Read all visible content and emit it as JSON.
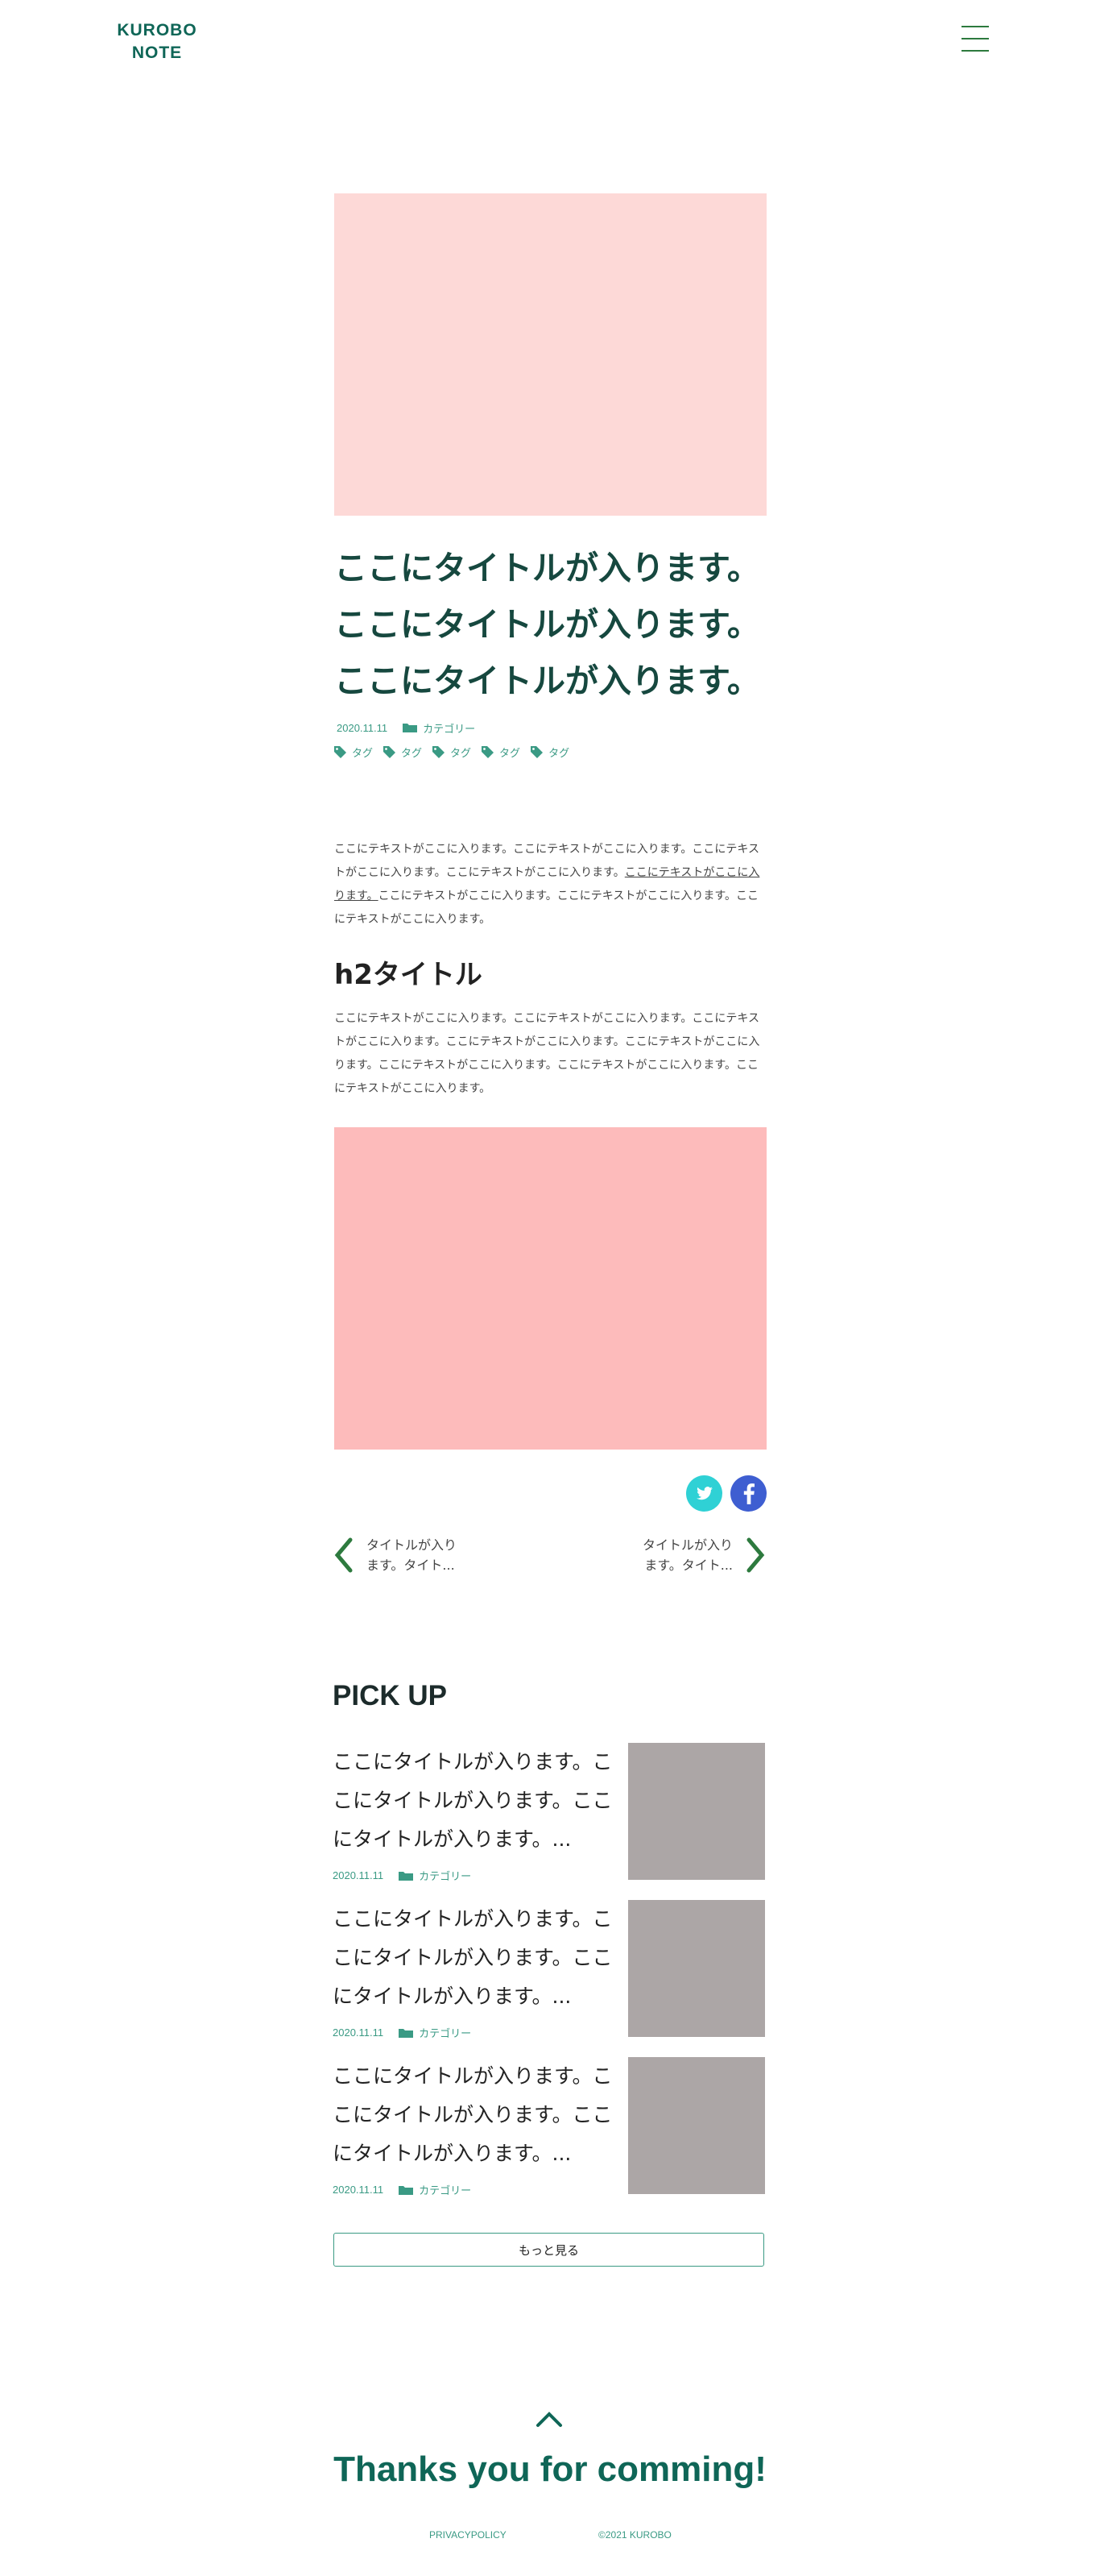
{
  "header": {
    "logo_line1": "KUROBO",
    "logo_line2": "NOTE",
    "menu_icon": "hamburger-icon"
  },
  "article": {
    "title": "ここにタイトルが入ります。ここにタイトルが入ります。ここにタイトルが入ります。",
    "date": "2020.11.11",
    "category": "カテゴリー",
    "tags": [
      "タグ",
      "タグ",
      "タグ",
      "タグ",
      "タグ"
    ],
    "intro_before_link": "ここにテキストがここに入ります。ここにテキストがここに入ります。ここにテキストがここに入ります。ここにテキストがここに入ります。",
    "intro_link": "ここにテキストがここに入ります。",
    "intro_after_link": "ここにテキストがここに入ります。ここにテキストがここに入ります。ここにテキストがここに入ります。",
    "h2": "h2タイトル",
    "body": "ここにテキストがここに入ります。ここにテキストがここに入ります。ここにテキストがここに入ります。ここにテキストがここに入ります。ここにテキストがここに入ります。ここにテキストがここに入ります。ここにテキストがここに入ります。ここにテキストがここに入ります。",
    "share": {
      "twitter_icon": "twitter-icon",
      "facebook_icon": "facebook-icon"
    },
    "prev_title": "タイトルが入ります。タイト...",
    "next_title": "タイトルが入ります。タイト..."
  },
  "pickup": {
    "heading": "PICK UP",
    "items": [
      {
        "title": "ここにタイトルが入ります。ここにタイトルが入ります。ここにタイトルが入ります。...",
        "date": "2020.11.11",
        "category": "カテゴリー"
      },
      {
        "title": "ここにタイトルが入ります。ここにタイトルが入ります。ここにタイトルが入ります。...",
        "date": "2020.11.11",
        "category": "カテゴリー"
      },
      {
        "title": "ここにタイトルが入ります。ここにタイトルが入ります。ここにタイトルが入ります。...",
        "date": "2020.11.11",
        "category": "カテゴリー"
      }
    ],
    "more_label": "もっと見る"
  },
  "footer": {
    "thanks": "Thanks you for comming!",
    "privacy": "PRIVACYPOLICY",
    "copyright": "©2021 KUROBO"
  },
  "colors": {
    "brand": "#0f6657",
    "accent": "#3a9a84",
    "hero": "#fdd9d7",
    "image2": "#fdbbbb",
    "thumb": "#aca6a6"
  }
}
